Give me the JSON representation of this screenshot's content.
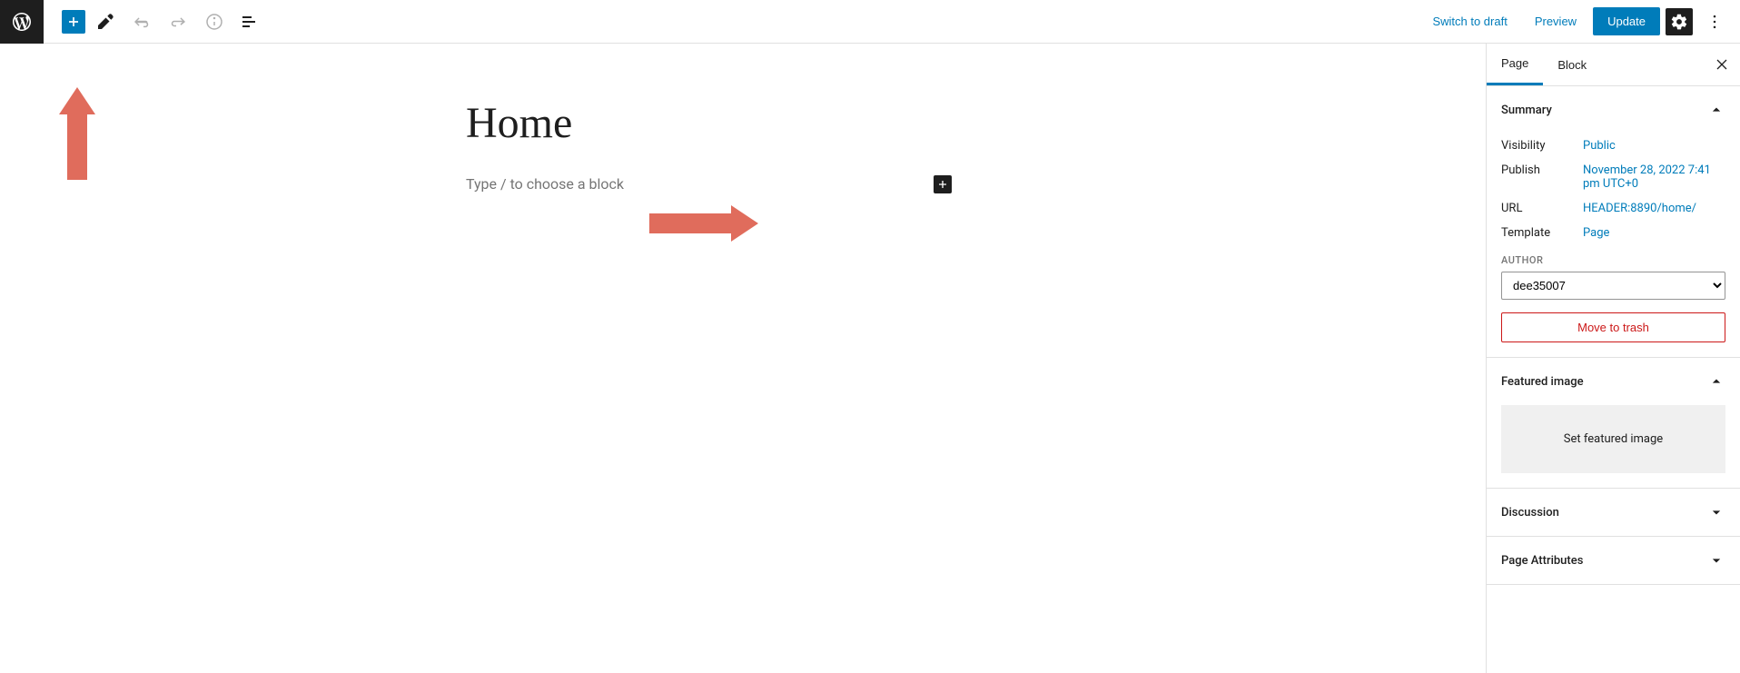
{
  "toolbar": {
    "switch_draft": "Switch to draft",
    "preview": "Preview",
    "update": "Update"
  },
  "content": {
    "title": "Home",
    "placeholder": "Type / to choose a block"
  },
  "sidebar": {
    "tabs": {
      "page": "Page",
      "block": "Block"
    },
    "summary": {
      "title": "Summary",
      "visibility_label": "Visibility",
      "visibility_value": "Public",
      "publish_label": "Publish",
      "publish_value": "November 28, 2022 7:41 pm UTC+0",
      "url_label": "URL",
      "url_value": "HEADER:8890/home/",
      "template_label": "Template",
      "template_value": "Page",
      "author_label": "AUTHOR",
      "author_value": "dee35007",
      "trash": "Move to trash"
    },
    "featured": {
      "title": "Featured image",
      "set": "Set featured image"
    },
    "discussion": {
      "title": "Discussion"
    },
    "attributes": {
      "title": "Page Attributes"
    }
  }
}
